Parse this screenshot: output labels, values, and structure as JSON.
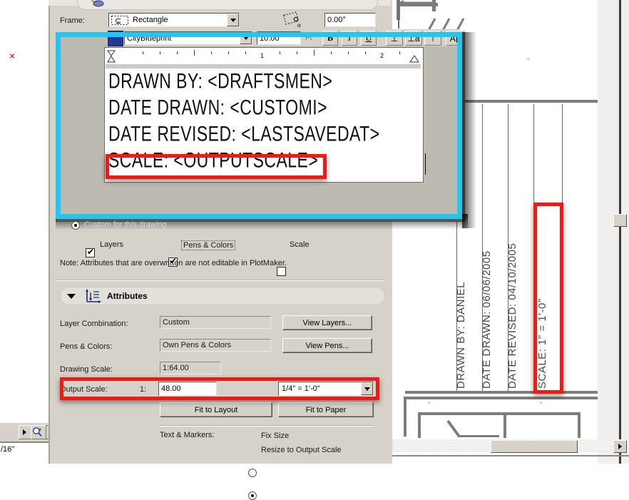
{
  "app": {
    "left_strip": {
      "scale_label": "/16\"",
      "close_marker": "×"
    }
  },
  "frame_row": {
    "label": "Frame:",
    "shape_value": "Rectangle",
    "shape_icon": "rectangle-frame-icon",
    "angle_icon": "rotation-angle-icon",
    "angle_value": "0.00°"
  },
  "text_editor": {
    "toolbar": {
      "color_swatch": "text-color-swatch",
      "font_name": "CityBlueprint",
      "font_size": "10.00",
      "size_unit": "Pt",
      "bold": "B",
      "italic": "I",
      "underline": "U",
      "align_left": "⊥",
      "align_sub": "⊥a",
      "align_center": "⊤",
      "text_style": "A▮"
    },
    "ruler": {
      "numbers": [
        "1",
        "2"
      ],
      "left_marker": "indent-marker-left",
      "right_marker": "indent-marker-right"
    },
    "lines": [
      "DRAWN BY: <DRAFTSMEN>",
      "DATE DRAWN: <CUSTOMI>",
      "DATE REVISED: <LASTSAVEDAT>",
      "SCALE: <OUTPUTSCALE>"
    ]
  },
  "overwrite_section": {
    "radio_custom": "Custom for this drawing",
    "checkboxes": [
      {
        "label": "Layers",
        "checked": true
      },
      {
        "label": "Pens & Colors",
        "checked": true
      },
      {
        "label": "Scale",
        "checked": false
      }
    ],
    "note": "Note: Attributes that are overwritten are not editable in PlotMaker."
  },
  "attributes": {
    "title": "Attributes",
    "icon": "attributes-axes-icon",
    "collapse_icon": "triangle-down-icon",
    "rows": [
      {
        "label": "Layer Combination:",
        "value": "Custom",
        "button": "View Layers..."
      },
      {
        "label": "Pens & Colors:",
        "value": "Own Pens & Colors",
        "button": "View Pens..."
      }
    ],
    "drawing_scale": {
      "label": "Drawing Scale:",
      "value": "1:64.00"
    },
    "output_scale": {
      "label": "Output Scale:",
      "prefix": "1:",
      "value": "48.00",
      "preset": "1/4\" =  1'-0\""
    },
    "fit_buttons": {
      "layout": "Fit to Layout",
      "paper": "Fit to Paper"
    },
    "text_markers": {
      "label": "Text & Markers:",
      "options": [
        {
          "label": "Fix Size",
          "selected": false
        },
        {
          "label": "Resize to Output Scale",
          "selected": true
        }
      ]
    }
  },
  "cad_drawing": {
    "title_block_lines": [
      "DRAWN BY: DANIEL",
      "DATE DRAWN: 06/06/2005",
      "DATE REVISED: 04/10/2005",
      "SCALE: 1\" = 1'-0\""
    ]
  },
  "highlights": {
    "cyan_color": "#24c5ee",
    "red_color": "#ee1b15",
    "cyan_target": "text-editor-window",
    "red_targets": [
      "scale-output-text-line",
      "output-scale-row",
      "cad-scale-label"
    ]
  }
}
